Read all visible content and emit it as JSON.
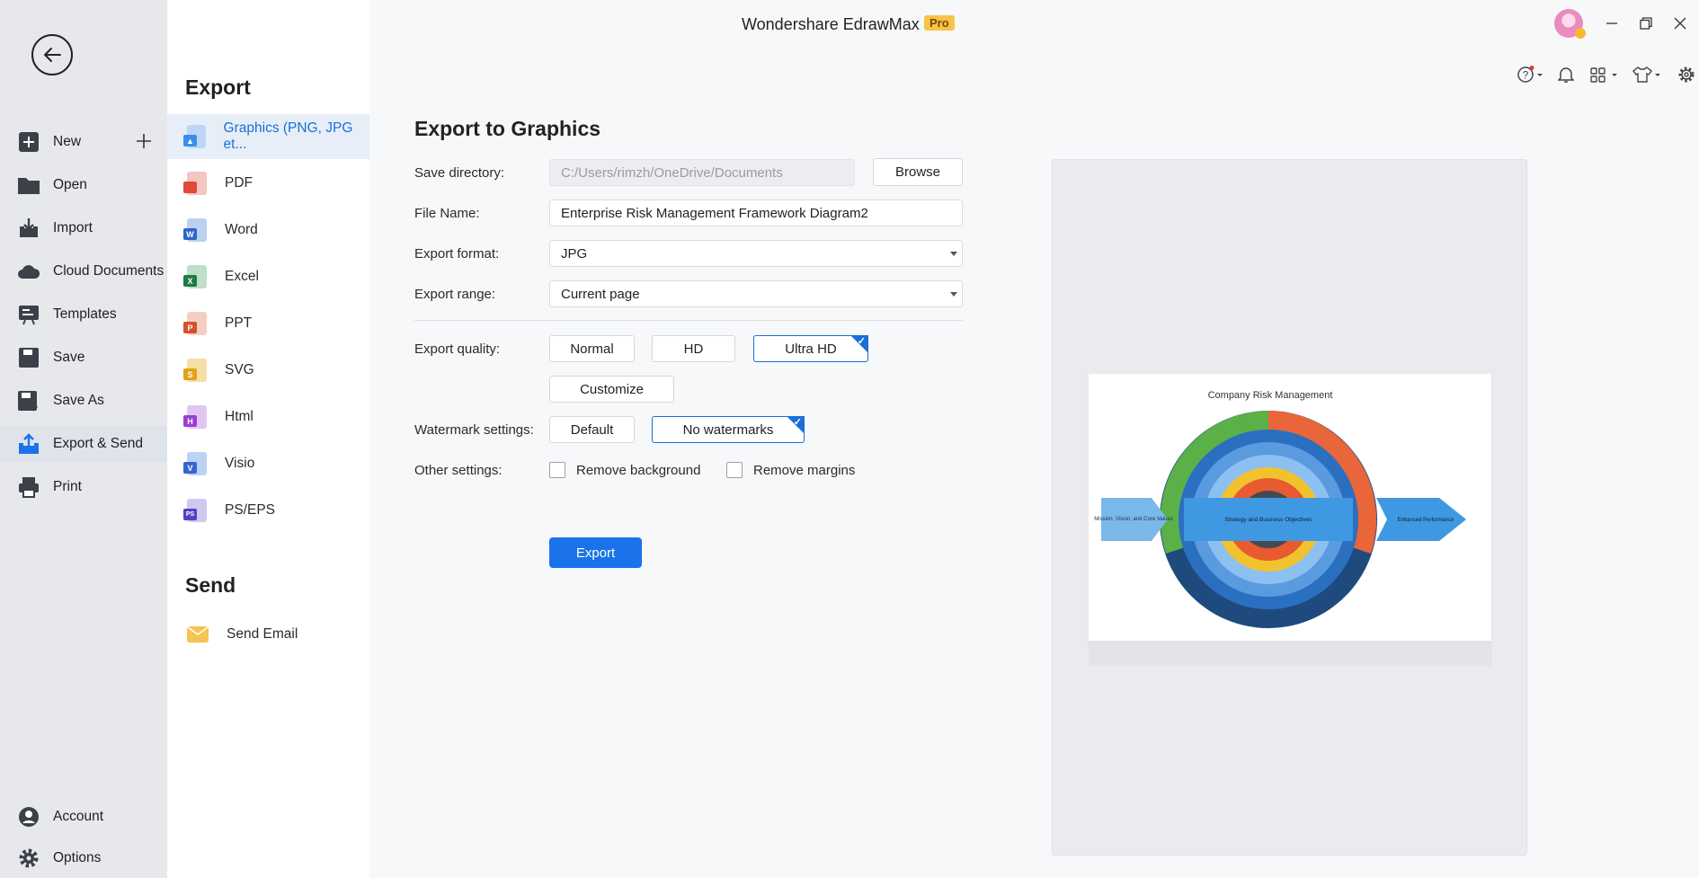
{
  "app": {
    "title": "Wondershare EdrawMax",
    "badge": "Pro"
  },
  "nav": {
    "items": [
      {
        "label": "New"
      },
      {
        "label": "Open"
      },
      {
        "label": "Import"
      },
      {
        "label": "Cloud Documents"
      },
      {
        "label": "Templates"
      },
      {
        "label": "Save"
      },
      {
        "label": "Save As"
      },
      {
        "label": "Export & Send"
      },
      {
        "label": "Print"
      }
    ],
    "bottom": [
      {
        "label": "Account"
      },
      {
        "label": "Options"
      }
    ]
  },
  "menu": {
    "export_heading": "Export",
    "items": [
      {
        "label": "Graphics (PNG, JPG et..."
      },
      {
        "label": "PDF",
        "tag": ""
      },
      {
        "label": "Word",
        "tag": "W"
      },
      {
        "label": "Excel",
        "tag": "X"
      },
      {
        "label": "PPT",
        "tag": "P"
      },
      {
        "label": "SVG",
        "tag": "S"
      },
      {
        "label": "Html",
        "tag": "H"
      },
      {
        "label": "Visio",
        "tag": "V"
      },
      {
        "label": "PS/EPS",
        "tag": "PS"
      }
    ],
    "send_heading": "Send",
    "send_items": [
      {
        "label": "Send Email"
      }
    ]
  },
  "form": {
    "title": "Export to Graphics",
    "save_directory": {
      "label": "Save directory:",
      "value": "C:/Users/rimzh/OneDrive/Documents",
      "browse": "Browse"
    },
    "file_name": {
      "label": "File Name:",
      "value": "Enterprise Risk Management Framework Diagram2"
    },
    "format": {
      "label": "Export format:",
      "value": "JPG"
    },
    "range": {
      "label": "Export range:",
      "value": "Current page"
    },
    "quality": {
      "label": "Export quality:",
      "options": [
        "Normal",
        "HD",
        "Ultra HD"
      ],
      "selected": "Ultra HD",
      "customize": "Customize"
    },
    "watermark": {
      "label": "Watermark settings:",
      "options": [
        "Default",
        "No watermarks"
      ],
      "selected": "No watermarks"
    },
    "other": {
      "label": "Other settings:",
      "remove_background": "Remove background",
      "remove_margins": "Remove margins"
    },
    "export_button": "Export",
    "check_glyph": "✓"
  },
  "preview": {
    "title": "Company Risk Management",
    "left_arrow": "Mission, Vision, and Core Values",
    "right_arrow": "Enhanced Performance",
    "center": "Strategy and Business Objectives"
  },
  "colors": {
    "accent": "#1a73e8",
    "selected_border": "#1a6fd6",
    "rail_bg": "#e6e8ec"
  }
}
